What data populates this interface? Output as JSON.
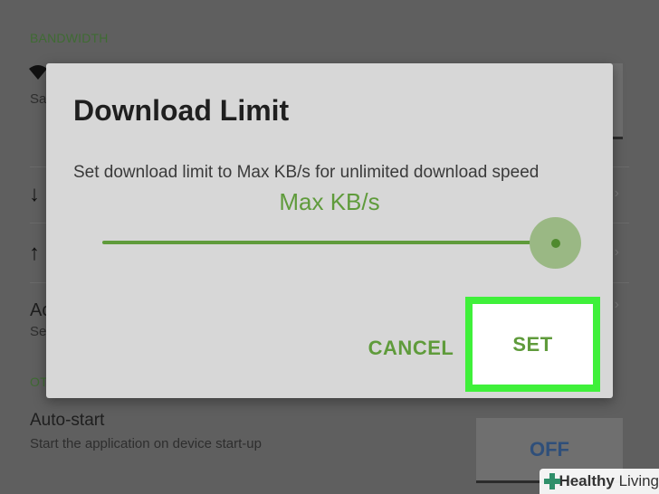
{
  "background": {
    "section_bandwidth": "BANDWIDTH",
    "wifi_sub": "Sa",
    "download_arrow": "↓",
    "upload_arrow": "↑",
    "row_title_partial": "Ac",
    "row_sub_partial": "Se",
    "section_other": "OT",
    "autostart_title": "Auto-start",
    "autostart_subtitle": "Start the application on device start-up",
    "autostart_toggle": "OFF"
  },
  "dialog": {
    "title": "Download Limit",
    "message": "Set download limit to Max KB/s for unlimited download speed",
    "value_label": "Max KB/s",
    "slider_value_fraction": 1.0,
    "cancel_label": "CANCEL",
    "set_label": "SET"
  },
  "watermark": {
    "brand_bold": "Healthy",
    "brand_regular": " Living"
  },
  "colors": {
    "accent": "#5f9b3b",
    "highlight": "#3ff03a",
    "dialog_bg": "#d7d7d7",
    "dim_bg": "#5f5f5f"
  }
}
